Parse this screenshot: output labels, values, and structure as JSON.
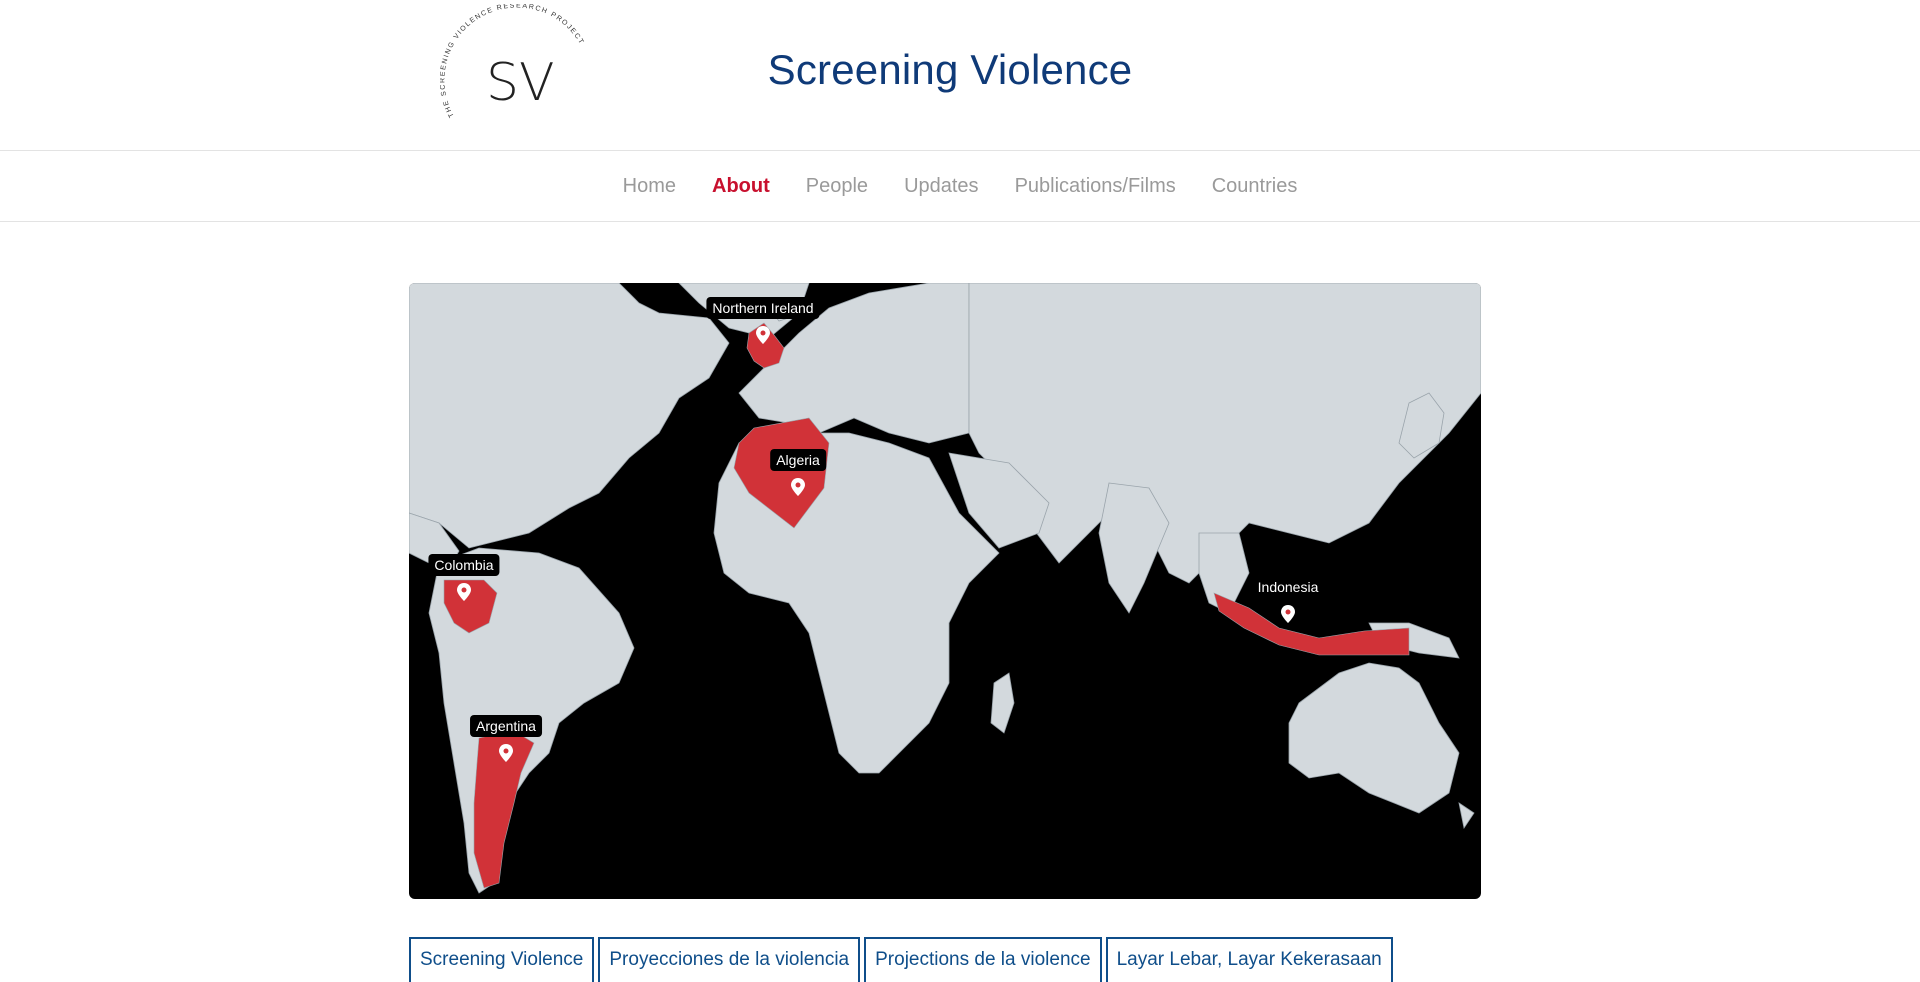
{
  "header": {
    "logo": {
      "initials": "SV",
      "ring_text": "THE SCREENING VIOLENCE RESEARCH PROJECT"
    },
    "title": "Screening Violence"
  },
  "nav": {
    "items": [
      {
        "label": "Home",
        "active": false
      },
      {
        "label": "About",
        "active": true
      },
      {
        "label": "People",
        "active": false
      },
      {
        "label": "Updates",
        "active": false
      },
      {
        "label": "Publications/Films",
        "active": false
      },
      {
        "label": "Countries",
        "active": false
      }
    ]
  },
  "map": {
    "colors": {
      "ocean": "#000000",
      "land": "#d3d9dd",
      "highlight": "#d13238"
    },
    "markers": [
      {
        "label": "Northern Ireland"
      },
      {
        "label": "Algeria"
      },
      {
        "label": "Colombia"
      },
      {
        "label": "Indonesia"
      },
      {
        "label": "Argentina"
      }
    ]
  },
  "tabs": [
    {
      "label": "Screening Violence"
    },
    {
      "label": "Proyecciones de la violencia"
    },
    {
      "label": "Projections de la violence"
    },
    {
      "label": "Layar Lebar, Layar Kekerasaan"
    }
  ],
  "colors": {
    "brand_blue": "#0f3a78",
    "active_red": "#c8102e",
    "nav_gray": "#9a9a9a"
  }
}
